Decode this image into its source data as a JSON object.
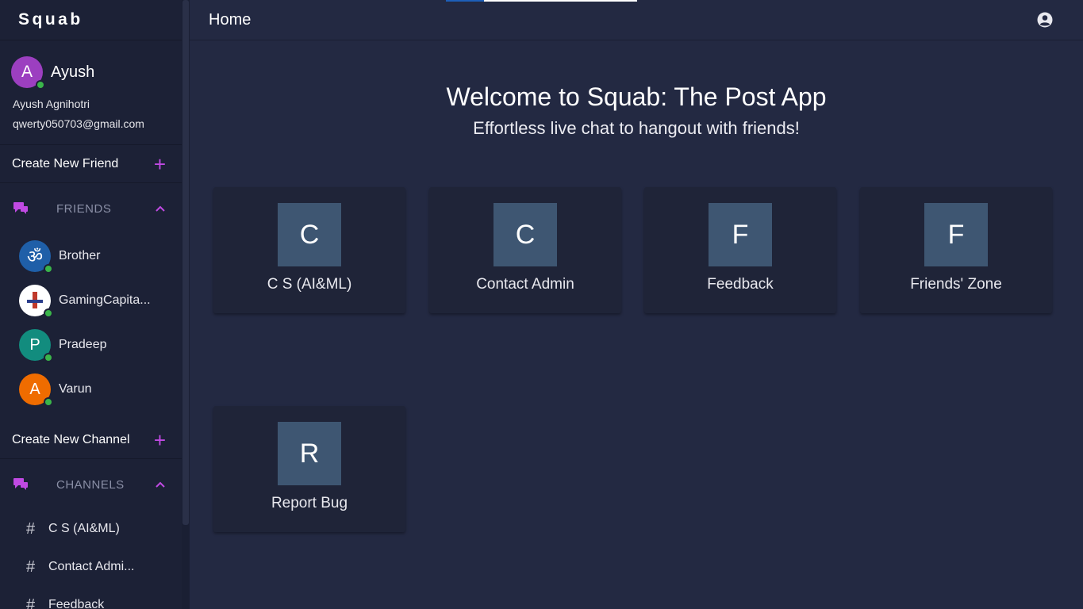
{
  "brand": "Squab",
  "user": {
    "initial": "A",
    "display_name": "Ayush",
    "full_name": "Ayush Agnihotri",
    "email": "qwerty050703@gmail.com",
    "avatar_color": "#9c3fc0",
    "status": "online"
  },
  "sidebar": {
    "create_friend_label": "Create New Friend",
    "friends_label": "FRIENDS",
    "friends": [
      {
        "name": "Brother",
        "avatar": "om-symbol"
      },
      {
        "name": "GamingCapita...",
        "avatar": "logo"
      },
      {
        "name": "Pradeep",
        "initial": "P",
        "color": "#128c7e"
      },
      {
        "name": "Varun",
        "initial": "A",
        "color": "#ef6c00"
      }
    ],
    "create_channel_label": "Create New Channel",
    "channels_label": "CHANNELS",
    "channels": [
      {
        "hash": "#",
        "name": "C S (AI&ML)"
      },
      {
        "hash": "#",
        "name": "Contact Admi..."
      },
      {
        "hash": "#",
        "name": "Feedback"
      }
    ]
  },
  "topbar": {
    "title": "Home",
    "account_icon": "account-circle-icon"
  },
  "main": {
    "heading": "Welcome to Squab: The Post App",
    "subheading": "Effortless live chat to hangout with friends!",
    "cards": [
      {
        "initial": "C",
        "name": "C S (AI&ML)"
      },
      {
        "initial": "C",
        "name": "Contact Admin"
      },
      {
        "initial": "F",
        "name": "Feedback"
      },
      {
        "initial": "F",
        "name": "Friends' Zone"
      },
      {
        "initial": "R",
        "name": "Report Bug"
      }
    ]
  },
  "colors": {
    "accent": "#c04ae3",
    "online": "#3ab54a",
    "tile": "#3e5672",
    "background": "#232942",
    "sidebar": "#1c2136"
  }
}
